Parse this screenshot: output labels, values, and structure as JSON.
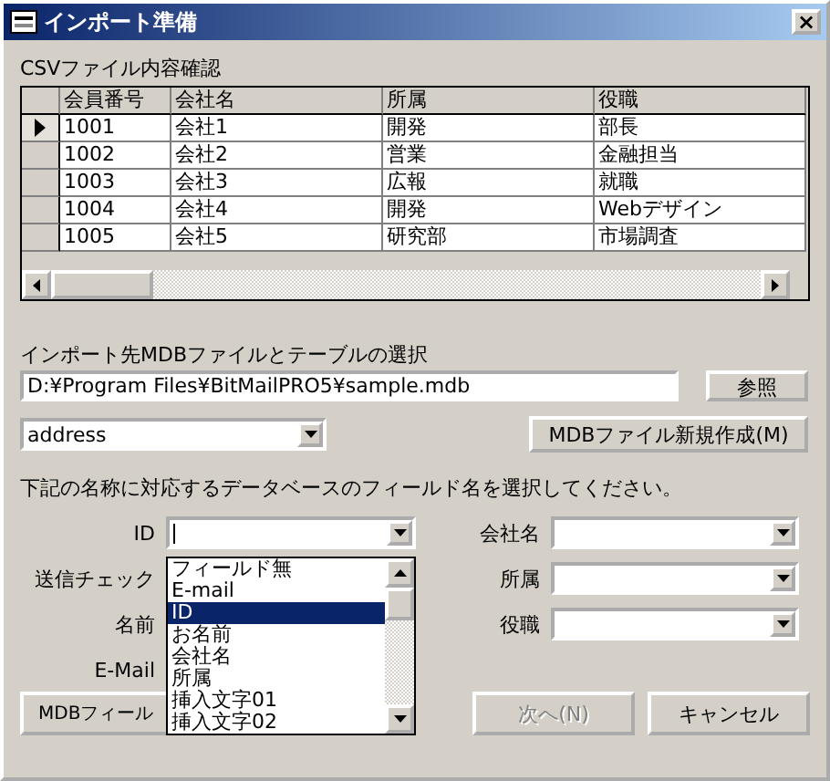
{
  "window": {
    "title": "インポート準備",
    "close": "×"
  },
  "csv_section": {
    "label": "CSVファイル内容確認"
  },
  "table": {
    "columns": [
      "会員番号",
      "会社名",
      "所属",
      "役職"
    ],
    "rows": [
      {
        "current": true,
        "cells": [
          "1001",
          "会社1",
          "開発",
          "部長"
        ]
      },
      {
        "current": false,
        "cells": [
          "1002",
          "会社2",
          "営業",
          "金融担当"
        ]
      },
      {
        "current": false,
        "cells": [
          "1003",
          "会社3",
          "広報",
          "就職"
        ]
      },
      {
        "current": false,
        "cells": [
          "1004",
          "会社4",
          "開発",
          "Webデザイン"
        ]
      },
      {
        "current": false,
        "cells": [
          "1005",
          "会社5",
          "研究部",
          "市場調査"
        ]
      }
    ]
  },
  "import_section": {
    "label": "インポート先MDBファイルとテーブルの選択",
    "path": "D:¥Program Files¥BitMailPRO5¥sample.mdb",
    "browse_button": "参照",
    "table_select": "address",
    "new_mdb_button": "MDBファイル新規作成(M)"
  },
  "instruction": "下記の名称に対応するデータベースのフィールド名を選択してください。",
  "left_fields": [
    {
      "label": "ID",
      "kind": "combo"
    },
    {
      "label": "送信チェック",
      "kind": "hidden"
    },
    {
      "label": "名前",
      "kind": "hidden"
    },
    {
      "label": "E-Mail",
      "kind": "hidden"
    }
  ],
  "right_fields": [
    {
      "label": "会社名"
    },
    {
      "label": "所属"
    },
    {
      "label": "役職"
    }
  ],
  "dropdown_list": {
    "options": [
      {
        "label": "フィールド無",
        "selected": false
      },
      {
        "label": "E-mail",
        "selected": false
      },
      {
        "label": "ID",
        "selected": true
      },
      {
        "label": "お名前",
        "selected": false
      },
      {
        "label": "会社名",
        "selected": false
      },
      {
        "label": "所属",
        "selected": false
      },
      {
        "label": "挿入文字01",
        "selected": false
      },
      {
        "label": "挿入文字02",
        "selected": false
      }
    ]
  },
  "buttons": [
    {
      "label": "MDBフィール",
      "disabled": false
    },
    {
      "label": "次へ(N)",
      "disabled": true
    },
    {
      "label": "キャンセル",
      "disabled": false
    }
  ]
}
